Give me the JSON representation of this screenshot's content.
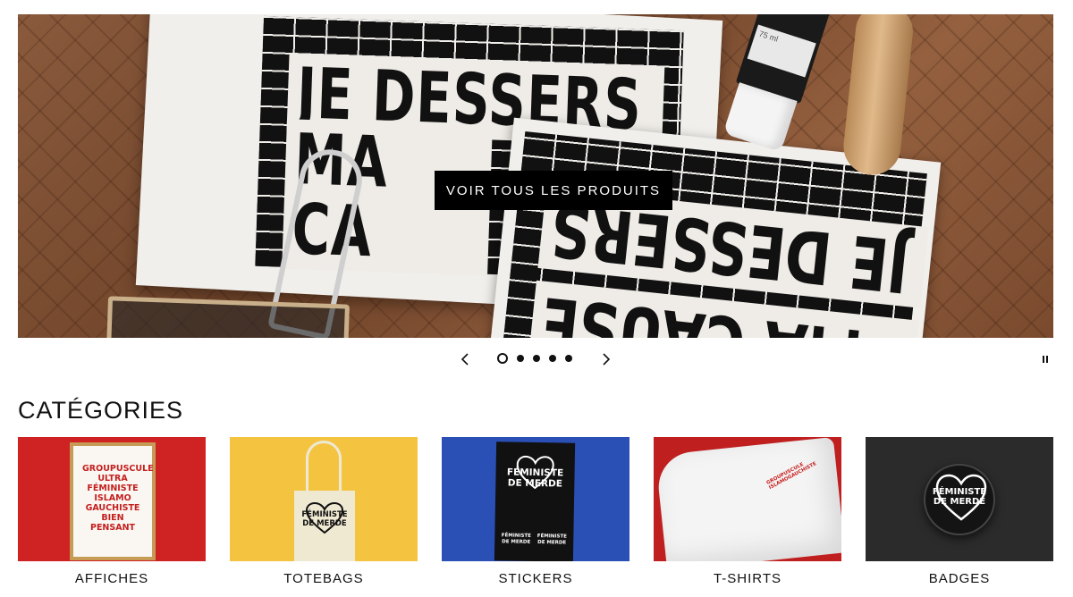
{
  "hero": {
    "cta_label": "VOIR TOUS LES PRODUITS",
    "print_a_line1": "JE DESSERS",
    "print_a_line2": "MA CA",
    "print_b_line1": "JE DESSERS",
    "print_b_line2": "MA CAUSE",
    "tube_label": "75 ml"
  },
  "slider": {
    "slide_count": 5,
    "active_slide": 1,
    "prev_icon": "chevron-left-icon",
    "next_icon": "chevron-right-icon",
    "pause_icon": "pause-icon"
  },
  "categories": {
    "title": "CATÉGORIES",
    "items": [
      {
        "label": "AFFICHES",
        "image_text": "GROUPUSCULE\nULTRA\nFÉMINISTE\nISLAMO\nGAUCHISTE\nBIEN\nPENSANT",
        "color": "#cf2323"
      },
      {
        "label": "TOTEBAGS",
        "image_text": "FÉMINISTE\nDE MERDE",
        "color": "#f4c441"
      },
      {
        "label": "STICKERS",
        "image_text": "FÉMINISTE\nDE MERDE",
        "mini_text": "FÉMINISTE\nDE MERDE",
        "color": "#2a4fb5"
      },
      {
        "label": "T-SHIRTS",
        "image_text": "GROUPUSCULE\nISLAMOGAUCHISTE",
        "color": "#c01f1f"
      },
      {
        "label": "BADGES",
        "image_text": "FÉMINISTE\nDE MERDE",
        "color": "#2b2b2b"
      }
    ]
  }
}
